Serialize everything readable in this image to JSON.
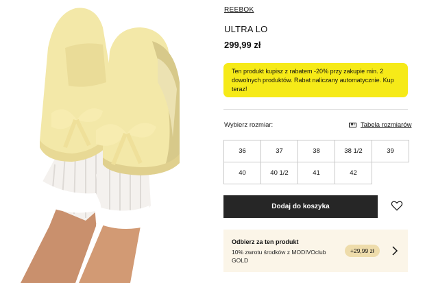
{
  "product": {
    "brand": "REEBOK",
    "name": "ULTRA LO",
    "price": "299,99 zł"
  },
  "promo": {
    "text": "Ten produkt kupisz z rabatem -20% przy zakupie min. 2 dowolnych produktów. Rabat naliczany automatycznie. Kup teraz!"
  },
  "size_section": {
    "label": "Wybierz rozmiar:",
    "chart_link": "Tabela rozmiarów",
    "sizes": [
      "36",
      "37",
      "38",
      "38 1/2",
      "39",
      "40",
      "40 1/2",
      "41",
      "42"
    ]
  },
  "actions": {
    "add_to_cart": "Dodaj do koszyka",
    "wishlist_icon": "heart-icon"
  },
  "club": {
    "title": "Odbierz za ten produkt",
    "text": "10% zwrotu środków z MODIVOclub GOLD",
    "badge": "+29,99 zł",
    "arrow_icon": "chevron-right-icon"
  },
  "colors": {
    "promo_bg": "#f6ea18",
    "button_bg": "#262626",
    "club_bg": "#fbf5e8",
    "club_badge_bg": "#eedcab",
    "shoe": "#f3e8a8"
  }
}
